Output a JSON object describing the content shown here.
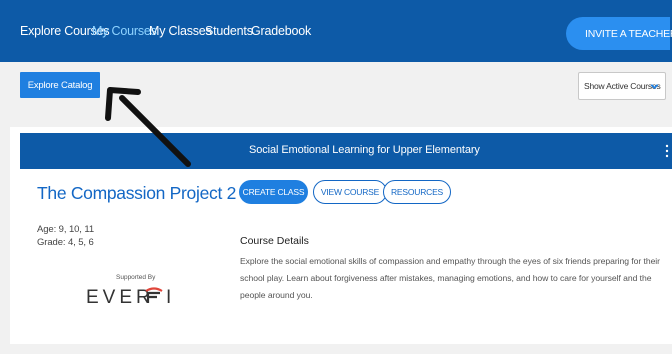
{
  "nav": {
    "items": [
      {
        "label": "Explore Courses",
        "active": false
      },
      {
        "label": "My Courses",
        "active": true
      },
      {
        "label": "My Classes",
        "active": false
      },
      {
        "label": "Students",
        "active": false
      },
      {
        "label": "Gradebook",
        "active": false
      }
    ],
    "invite_label": "INVITE A TEACHER"
  },
  "toolbar": {
    "explore_catalog_label": "Explore Catalog",
    "filter_selected": "Show Active Courses"
  },
  "course": {
    "header_title": "Social Emotional Learning for Upper Elementary",
    "title": "The Compassion Project 2",
    "age": "Age: 9, 10, 11",
    "grade": "Grade: 4, 5, 6",
    "supported_by": "Supported By",
    "sponsor": "EVERFI",
    "buttons": {
      "create_class": "CREATE CLASS",
      "view_course": "VIEW COURSE",
      "resources": "RESOURCES"
    },
    "details_heading": "Course Details",
    "details_body": "Explore the social emotional skills of compassion and empathy through the eyes of six friends preparing for their school play. Learn about forgiveness after mistakes, managing emotions, and how to care for yourself and the people around you."
  },
  "colors": {
    "nav_bg": "#0d5aa7",
    "active_nav": "#8fd3ff",
    "primary_button": "#1f7fe0",
    "link_blue": "#1367c5"
  },
  "icons": {
    "invite": "send-arrow-icon",
    "filter": "chevron-down-icon",
    "card_menu": "kebab-menu-icon",
    "annotation": "pointer-arrow-icon"
  }
}
